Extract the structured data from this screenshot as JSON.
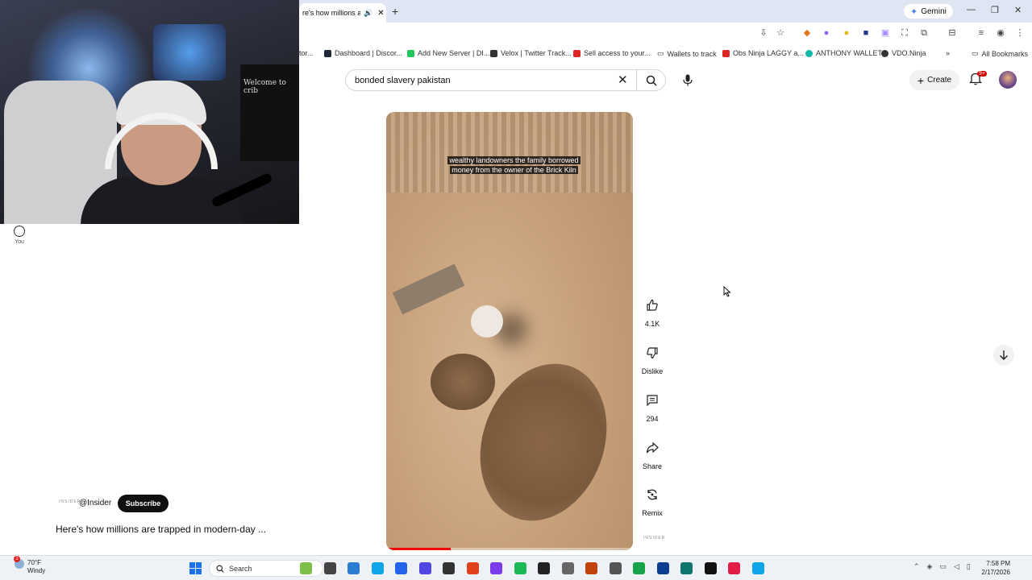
{
  "browser": {
    "active_tab_title": "re's how millions ar",
    "new_tab_label": "+",
    "gemini_label": "Gemini",
    "window_controls": {
      "minimize": "—",
      "restore": "❐",
      "close": "✕"
    },
    "bookmarks": [
      {
        "label": "tor...",
        "color": "#555555"
      },
      {
        "label": "Dashboard | Discor...",
        "color": "#1f2937"
      },
      {
        "label": "Add New Server | DI...",
        "color": "#22c55e"
      },
      {
        "label": "Velox | Twitter Track...",
        "color": "#333333"
      },
      {
        "label": "Sell access to your...",
        "color": "#dc2626"
      },
      {
        "label": "Wallets to track",
        "color": "#555555"
      },
      {
        "label": "Obs Ninja LAGGY a...",
        "color": "#dc2626"
      },
      {
        "label": "ANTHONY WALLET",
        "color": "#14b8a6"
      },
      {
        "label": "VDO.Ninja",
        "color": "#333333"
      }
    ],
    "bookmarks_more": "»",
    "all_bookmarks_label": "All Bookmarks"
  },
  "webcam": {
    "banner_text": "Welcome to crib"
  },
  "youtube": {
    "you_label": "You",
    "search": {
      "value": "bonded slavery pakistan"
    },
    "create_label": "Create",
    "notifications_badge": "9+",
    "video": {
      "caption_line1": "wealthy landowners the family borrowed",
      "caption_line2": "money from the owner of the Brick Kiln",
      "progress_fraction": 0.26
    },
    "actions": {
      "like_count": "4.1K",
      "dislike_label": "Dislike",
      "comments_count": "294",
      "share_label": "Share",
      "remix_label": "Remix"
    },
    "channel": {
      "logo_text": "INSIDER",
      "handle": "@Insider",
      "subscribe_label": "Subscribe"
    },
    "video_title": "Here's how millions are trapped in modern-day ..."
  },
  "taskbar": {
    "weather_temp": "70°F",
    "weather_desc": "Windy",
    "weather_badge": "2",
    "search_label": "Search",
    "time": "7:58 PM",
    "date": "2/17/2026",
    "app_colors": [
      "#7cc04a",
      "#444444",
      "#2b7cd3",
      "#0ea5e9",
      "#2563eb",
      "#4f46e5",
      "#333333",
      "#e0401a",
      "#7c3aed",
      "#1db954",
      "#222222",
      "#666666",
      "#c2410c",
      "#555555",
      "#16a34a",
      "#0b3d91",
      "#0f766e",
      "#111111",
      "#e11d48",
      "#0ea5e9"
    ]
  },
  "colors": {
    "accent_red": "#ff0000",
    "subscribe_bg": "#0f0f0f",
    "tabstrip_bg": "#dfe5f2"
  }
}
